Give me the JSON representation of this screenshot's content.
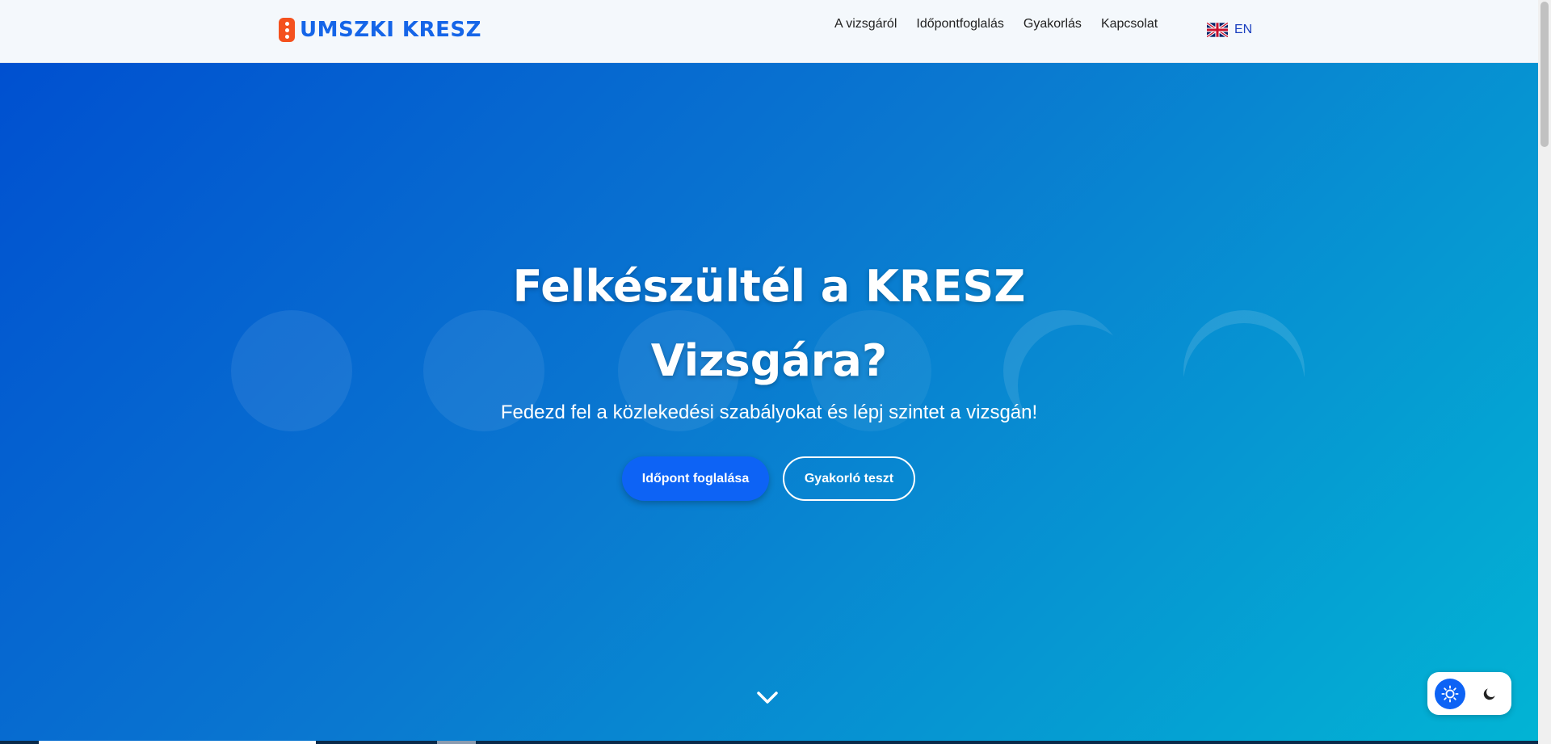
{
  "header": {
    "logo_text": "UMSZKI KRESZ",
    "nav": [
      "A vizsgáról",
      "Időpontfoglalás",
      "Gyakorlás",
      "Kapcsolat"
    ],
    "language": "EN"
  },
  "hero": {
    "title_line1": "Felkészültél a KRESZ",
    "title_line2": "Vizsgára?",
    "subtitle": "Fedezd fel a közlekedési szabályokat és lépj szintet a vizsgán!",
    "primary_button": "Időpont foglalása",
    "secondary_button": "Gyakorló teszt"
  },
  "theme": {
    "active": "light"
  },
  "colors": {
    "brand": "#1565e8",
    "accent": "#0d63f5",
    "logo_icon": "#f4511e",
    "hero_gradient_start": "#0050d0",
    "hero_gradient_end": "#02b4d4"
  },
  "icons": [
    "traffic-light-icon",
    "uk-flag-icon",
    "chevron-down-icon",
    "sun-icon",
    "moon-icon"
  ]
}
